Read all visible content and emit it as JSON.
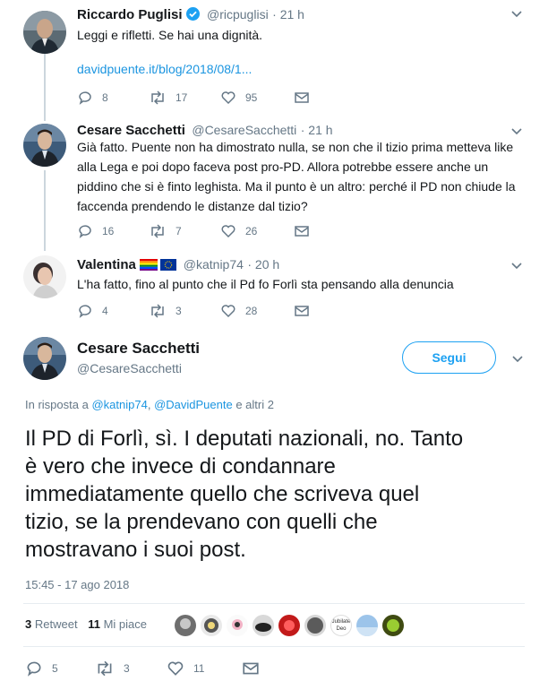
{
  "colors": {
    "accent": "#1da1f2",
    "link": "#1b95e0",
    "muted": "#657786",
    "line": "#ccd6dd"
  },
  "tweets": [
    {
      "name": "Riccardo Puglisi",
      "verified": true,
      "handle": "@ricpuglisi",
      "time": "· 21 h",
      "text_line1": "Leggi e rifletti. Se hai una dignità.",
      "link": "davidpuente.it/blog/2018/08/1...",
      "replies": "8",
      "retweets": "17",
      "likes": "95"
    },
    {
      "name": "Cesare Sacchetti",
      "handle": "@CesareSacchetti",
      "time": "· 21 h",
      "lines": [
        "Già fatto. Puente non ha dimostrato nulla, se non che il tizio prima metteva like",
        "alla Lega e poi dopo faceva post pro-PD. Allora potrebbe essere anche un",
        "piddino che si è finto leghista. Ma il punto è un altro: perché il PD non chiude la",
        "faccenda prendendo le distanze dal tizio?"
      ],
      "replies": "16",
      "retweets": "7",
      "likes": "26"
    },
    {
      "name": "Valentina",
      "handle": "@katnip74",
      "time": "· 20 h",
      "text": "L'ha fatto, fino al punto che il Pd fo Forlì sta pensando alla denuncia",
      "replies": "4",
      "retweets": "3",
      "likes": "28"
    }
  ],
  "main": {
    "name": "Cesare Sacchetti",
    "handle": "@CesareSacchetti",
    "follow_label": "Segui",
    "reply_prefix": "In risposta a",
    "reply_to_1": "@katnip74",
    "reply_sep": ",",
    "reply_to_2": "@DavidPuente",
    "reply_suffix": "e altri 2",
    "lines": [
      "Il PD di Forlì, sì. I deputati nazionali, no. Tanto",
      "è vero che invece di condannare",
      "immediatamente quello che scriveva quel",
      "tizio, se la prendevano con quelli che",
      "mostravano i suoi post."
    ],
    "timestamp": "15:45 - 17 ago 2018",
    "retweet_count": "3",
    "retweet_label": "Retweet",
    "like_count": "11",
    "like_label": "Mi piace",
    "replies": "5",
    "retweets": "3",
    "likes": "11",
    "liker_avatars": [
      "liker-avatar",
      "liker-avatar",
      "liker-avatar",
      "liker-avatar",
      "liker-avatar",
      "liker-avatar",
      "liker-avatar",
      "liker-avatar",
      "liker-avatar"
    ],
    "liker_badge_text": [
      "Jubilate",
      "Deo"
    ]
  }
}
